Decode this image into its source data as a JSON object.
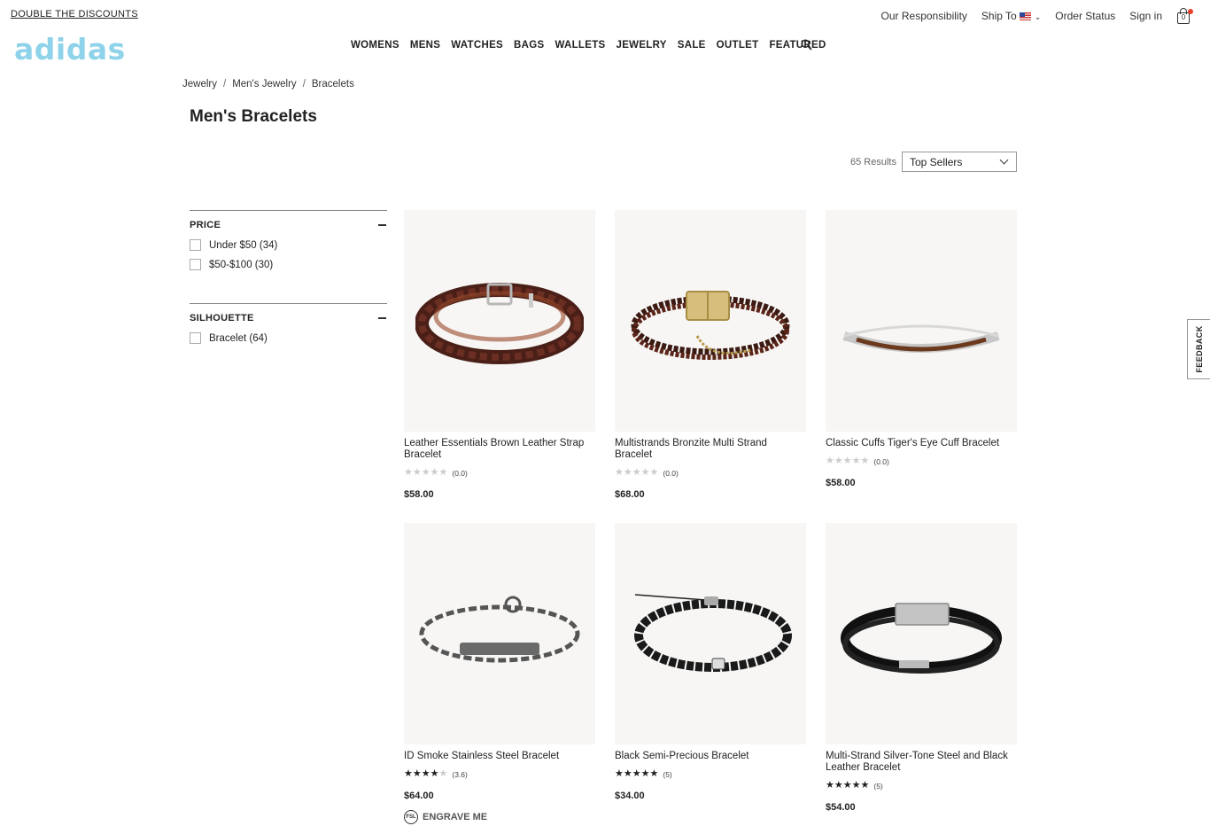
{
  "promo": "DOUBLE THE DISCOUNTS",
  "utility": {
    "responsibility": "Our Responsibility",
    "ship_to": "Ship To",
    "order_status": "Order Status",
    "sign_in": "Sign in",
    "cart_count": "0"
  },
  "logo": "adidas",
  "nav": [
    "WOMENS",
    "MENS",
    "WATCHES",
    "BAGS",
    "WALLETS",
    "JEWELRY",
    "SALE",
    "OUTLET",
    "FEATURED"
  ],
  "breadcrumb": [
    "Jewelry",
    "Men's Jewelry",
    "Bracelets"
  ],
  "page_title": "Men's Bracelets",
  "results_count": "65 Results",
  "sort": {
    "selected": "Top Sellers"
  },
  "filters": [
    {
      "title": "PRICE",
      "options": [
        "Under $50 (34)",
        "$50-$100 (30)"
      ]
    },
    {
      "title": "SILHOUETTE",
      "options": [
        "Bracelet (64)"
      ]
    }
  ],
  "products": [
    {
      "name": "Leather Essentials Brown Leather Strap Bracelet",
      "rating": 0,
      "rating_text": "(0.0)",
      "price": "$58.00"
    },
    {
      "name": "Multistrands Bronzite Multi Strand Bracelet",
      "rating": 0,
      "rating_text": "(0.0)",
      "price": "$68.00"
    },
    {
      "name": "Classic Cuffs Tiger's Eye Cuff Bracelet",
      "rating": 0,
      "rating_text": "(0.0)",
      "price": "$58.00"
    },
    {
      "name": "ID Smoke Stainless Steel Bracelet",
      "rating": 3.6,
      "rating_text": "(3.6)",
      "price": "$64.00",
      "engrave": "ENGRAVE ME",
      "engrave_badge": "FSL"
    },
    {
      "name": "Black Semi-Precious Bracelet",
      "rating": 5,
      "rating_text": "(5)",
      "price": "$34.00"
    },
    {
      "name": "Multi-Strand Silver-Tone Steel and Black Leather Bracelet",
      "rating": 5,
      "rating_text": "(5)",
      "price": "$54.00"
    }
  ],
  "feedback": "FEEDBACK",
  "colors": {
    "logo": "#8fd3ea",
    "tile_bg": "#f7f6f4",
    "cart_dot": "#e8412a"
  }
}
